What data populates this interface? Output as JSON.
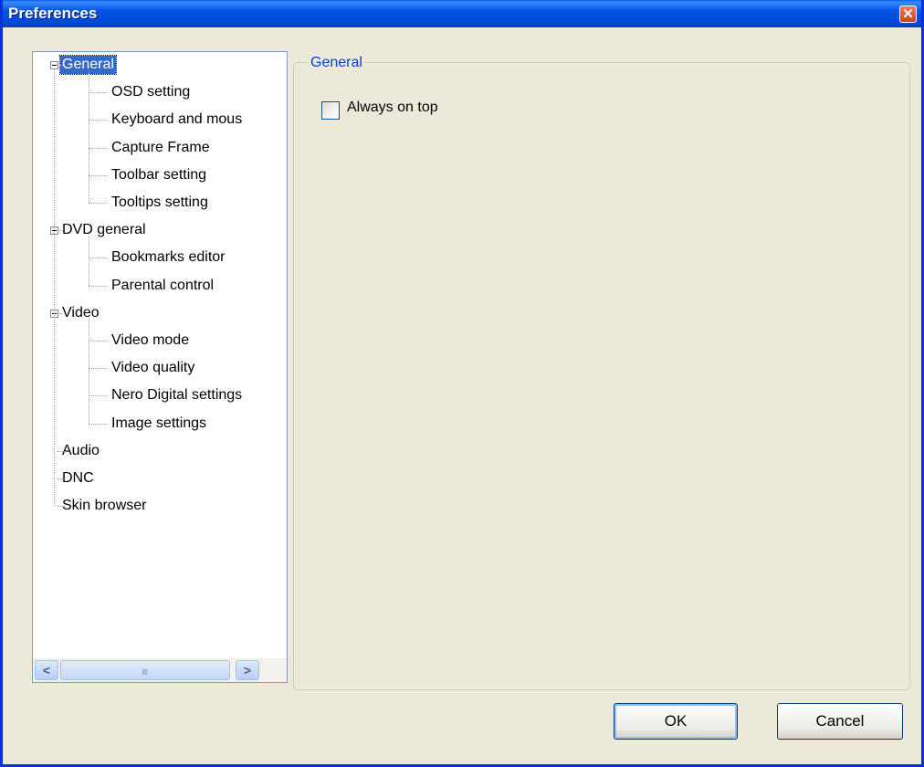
{
  "window": {
    "title": "Preferences",
    "close_symbol": "✕"
  },
  "tree": {
    "items": [
      {
        "label": "General",
        "level": 0,
        "expander": "minus",
        "selected": true
      },
      {
        "label": "OSD setting",
        "level": 1
      },
      {
        "label": "Keyboard and mous",
        "level": 1
      },
      {
        "label": "Capture Frame",
        "level": 1
      },
      {
        "label": "Toolbar setting",
        "level": 1
      },
      {
        "label": "Tooltips setting",
        "level": 1
      },
      {
        "label": "DVD general",
        "level": 0,
        "expander": "minus"
      },
      {
        "label": "Bookmarks editor",
        "level": 1
      },
      {
        "label": "Parental control",
        "level": 1
      },
      {
        "label": "Video",
        "level": 0,
        "expander": "minus"
      },
      {
        "label": "Video mode",
        "level": 1
      },
      {
        "label": "Video quality",
        "level": 1
      },
      {
        "label": "Nero Digital settings",
        "level": 1
      },
      {
        "label": "Image settings",
        "level": 1
      },
      {
        "label": "Audio",
        "level": 0
      },
      {
        "label": "DNC",
        "level": 0
      },
      {
        "label": "Skin browser",
        "level": 0
      }
    ]
  },
  "scrollbar": {
    "left_arrow": "<",
    "right_arrow": ">",
    "grip": "IIII"
  },
  "panel": {
    "group_title": "General",
    "always_on_top_label": "Always on top",
    "always_on_top_checked": false
  },
  "buttons": {
    "ok_label": "OK",
    "cancel_label": "Cancel"
  },
  "colors": {
    "titlebar": "#0055E5",
    "selection": "#316AC5",
    "group_title": "#0046D5",
    "dialog_bg": "#ECE9D8"
  }
}
